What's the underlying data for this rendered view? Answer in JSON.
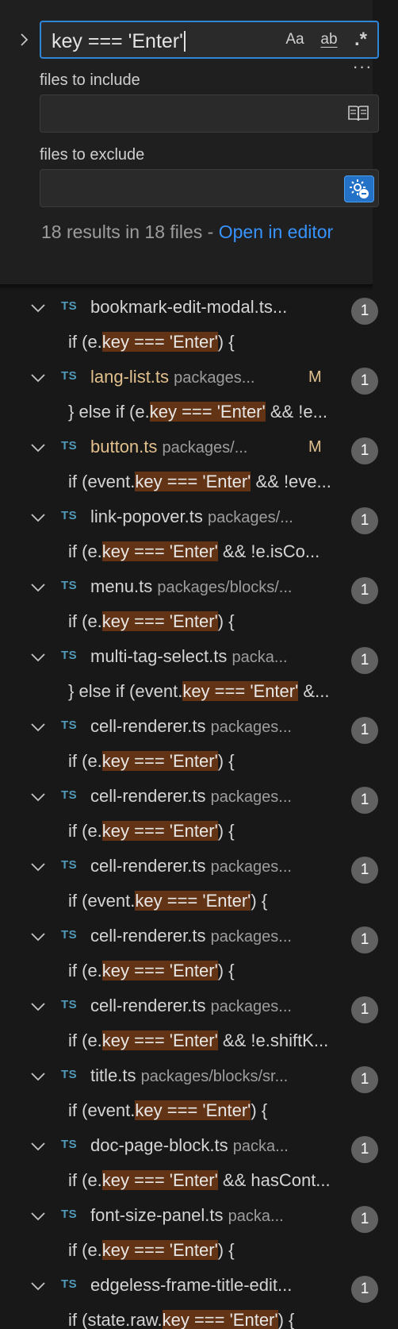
{
  "search": {
    "query": "key === 'Enter'",
    "case_label": "Aa",
    "word_label": "ab",
    "regex_label": ".*",
    "more_label": "···"
  },
  "include": {
    "label": "files to include",
    "value": ""
  },
  "exclude": {
    "label": "files to exclude",
    "value": ""
  },
  "summary": {
    "text": "18 results in 18 files - ",
    "link": "Open in editor"
  },
  "results": [
    {
      "name": "bookmark-edit-modal.ts...",
      "path": "",
      "modified": false,
      "count": "1",
      "pre": "if (e.",
      "hl": "key === 'Enter'",
      "post": ") {"
    },
    {
      "name": "lang-list.ts",
      "path": "packages...",
      "modified": true,
      "count": "1",
      "pre": "} else if (e.",
      "hl": "key === 'Enter'",
      "post": " && !e..."
    },
    {
      "name": "button.ts",
      "path": "packages/...",
      "modified": true,
      "count": "1",
      "pre": "if (event.",
      "hl": "key === 'Enter'",
      "post": " && !eve..."
    },
    {
      "name": "link-popover.ts",
      "path": "packages/...",
      "modified": false,
      "count": "1",
      "pre": "if (e.",
      "hl": "key === 'Enter'",
      "post": " && !e.isCo..."
    },
    {
      "name": "menu.ts",
      "path": "packages/blocks/...",
      "modified": false,
      "count": "1",
      "pre": "if (e.",
      "hl": "key === 'Enter'",
      "post": ") {"
    },
    {
      "name": "multi-tag-select.ts",
      "path": "packa...",
      "modified": false,
      "count": "1",
      "pre": "} else if (event.",
      "hl": "key === 'Enter'",
      "post": " &..."
    },
    {
      "name": "cell-renderer.ts",
      "path": "packages...",
      "modified": false,
      "count": "1",
      "pre": "if (e.",
      "hl": "key === 'Enter'",
      "post": ") {"
    },
    {
      "name": "cell-renderer.ts",
      "path": "packages...",
      "modified": false,
      "count": "1",
      "pre": "if (e.",
      "hl": "key === 'Enter'",
      "post": ") {"
    },
    {
      "name": "cell-renderer.ts",
      "path": "packages...",
      "modified": false,
      "count": "1",
      "pre": "if (event.",
      "hl": "key === 'Enter'",
      "post": ") {"
    },
    {
      "name": "cell-renderer.ts",
      "path": "packages...",
      "modified": false,
      "count": "1",
      "pre": "if (e.",
      "hl": "key === 'Enter'",
      "post": ") {"
    },
    {
      "name": "cell-renderer.ts",
      "path": "packages...",
      "modified": false,
      "count": "1",
      "pre": "if (e.",
      "hl": "key === 'Enter'",
      "post": " && !e.shiftK..."
    },
    {
      "name": "title.ts",
      "path": "packages/blocks/sr...",
      "modified": false,
      "count": "1",
      "pre": "if (event.",
      "hl": "key === 'Enter'",
      "post": ") {"
    },
    {
      "name": "doc-page-block.ts",
      "path": "packa...",
      "modified": false,
      "count": "1",
      "pre": "if (e.",
      "hl": "key === 'Enter'",
      "post": " && hasCont..."
    },
    {
      "name": "font-size-panel.ts",
      "path": "packa...",
      "modified": false,
      "count": "1",
      "pre": "if (e.",
      "hl": "key === 'Enter'",
      "post": ") {"
    },
    {
      "name": "edgeless-frame-title-edit...",
      "path": "",
      "modified": false,
      "count": "1",
      "pre": "if (state.raw.",
      "hl": "key === 'Enter'",
      "post": ") {"
    }
  ],
  "file_type_label": "TS",
  "modified_label": "M",
  "colors": {
    "accent": "#2f86d6",
    "highlight": "#623315",
    "modified": "#e2c08d",
    "ts_icon": "#519aba",
    "link": "#3794ff"
  }
}
